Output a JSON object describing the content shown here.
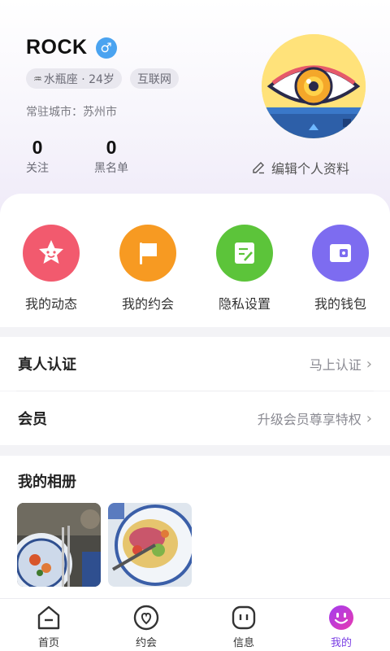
{
  "profile": {
    "username": "ROCK",
    "gender_symbol": "♂",
    "zodiac_tag": "水瓶座 · 24岁",
    "zodiac_glyph": "♒",
    "industry_tag": "互联网",
    "city": "常驻城市：苏州市",
    "follow_count": "0",
    "follow_label": "关注",
    "blacklist_count": "0",
    "blacklist_label": "黑名单",
    "edit_label": "编辑个人资料"
  },
  "quick_actions": [
    {
      "label": "我的动态",
      "icon": "star-face-icon",
      "color": "#f25a6e"
    },
    {
      "label": "我的约会",
      "icon": "flag-icon",
      "color": "#f79a22"
    },
    {
      "label": "隐私设置",
      "icon": "note-pencil-icon",
      "color": "#5cc43a"
    },
    {
      "label": "我的钱包",
      "icon": "wallet-icon",
      "color": "#7d6cf0"
    }
  ],
  "verification": {
    "title": "真人认证",
    "action": "马上认证"
  },
  "membership": {
    "title": "会员",
    "action": "升级会员尊享特权"
  },
  "album": {
    "title": "我的相册"
  },
  "tabs": [
    {
      "label": "首页",
      "icon": "home-icon"
    },
    {
      "label": "约会",
      "icon": "heart-icon"
    },
    {
      "label": "信息",
      "icon": "message-icon"
    },
    {
      "label": "我的",
      "icon": "profile-face-icon",
      "active": true
    }
  ],
  "colors": {
    "accent": "#7b3fe4",
    "gender_badge": "#4aa3f0"
  }
}
